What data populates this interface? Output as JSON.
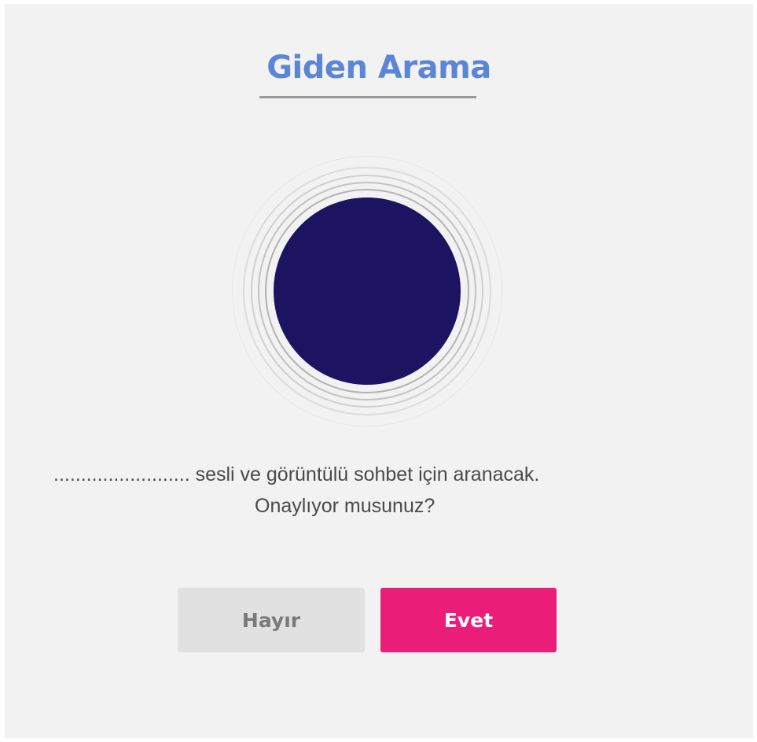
{
  "dialog": {
    "title": "Giden Arama",
    "message_line1": "......................... sesli ve görüntülü sohbet için aranacak.",
    "message_line2": "Onaylıyor musunuz?",
    "no_label": "Hayır",
    "yes_label": "Evet"
  },
  "colors": {
    "title": "#5b86d8",
    "avatar": "#1c1461",
    "yes_button": "#ea1e79",
    "no_button": "#e1e1e1"
  }
}
